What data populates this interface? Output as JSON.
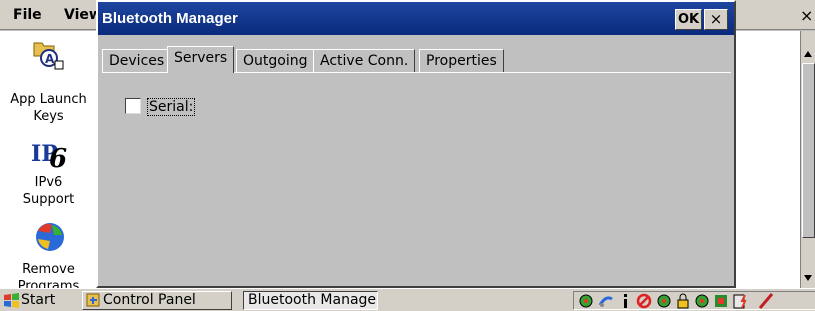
{
  "background_window": {
    "menu": {
      "file_label": "File",
      "view_label": "View"
    },
    "close_label": "×",
    "items": [
      {
        "label_line1": "App Launch",
        "label_line2": "Keys"
      },
      {
        "label_line1": "IPv6",
        "label_line2": "Support"
      },
      {
        "label_line1": "Remove",
        "label_line2": "Programs"
      }
    ]
  },
  "dialog": {
    "title": "Bluetooth Manager",
    "ok_label": "OK",
    "close_label": "×",
    "tabs": [
      {
        "label": "Devices"
      },
      {
        "label": "Servers"
      },
      {
        "label": "Outgoing"
      },
      {
        "label": "Active Conn."
      },
      {
        "label": "Properties"
      }
    ],
    "active_tab": "Servers",
    "serial": {
      "label": "Serial:",
      "checked": false
    }
  },
  "taskbar": {
    "start_label": "Start",
    "tasks": [
      {
        "label": "Control Panel"
      },
      {
        "label": "Bluetooth Manager"
      }
    ],
    "tray_icons": [
      "network-icon",
      "connection-icon",
      "info-icon",
      "no-signal-icon",
      "network-icon",
      "lock-icon",
      "network-icon",
      "flag-icon",
      "battery-icon",
      "pen-icon"
    ]
  }
}
